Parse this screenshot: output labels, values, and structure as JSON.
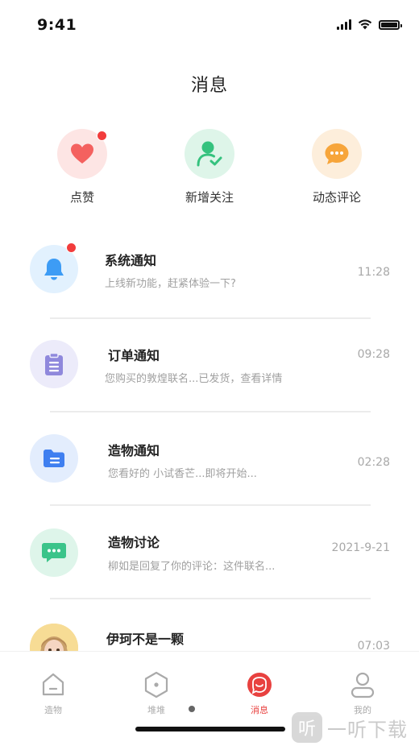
{
  "status_bar": {
    "time": "9:41"
  },
  "header": {
    "title": "消息"
  },
  "quick_actions": [
    {
      "label": "点赞",
      "icon": "heart-icon",
      "color": "#f4615f",
      "bg": "#fde5e4",
      "badge": true
    },
    {
      "label": "新增关注",
      "icon": "user-check-icon",
      "color": "#35c27e",
      "bg": "#def5e9",
      "badge": false
    },
    {
      "label": "动态评论",
      "icon": "chat-bubble-icon",
      "color": "#f7a53a",
      "bg": "#fdeedb",
      "badge": false
    }
  ],
  "messages": [
    {
      "title": "系统通知",
      "preview": "上线新功能，赶紧体验一下?",
      "time": "11:28",
      "icon": "bell-icon",
      "color": "#3d9cf5",
      "bg": "#e2f1fe",
      "badge": true
    },
    {
      "title": "订单通知",
      "preview": "您购买的敦煌联名...已发货，查看详情",
      "time": "09:28",
      "icon": "clipboard-icon",
      "color": "#8f88dc",
      "bg": "#ecebfa",
      "badge": false
    },
    {
      "title": "造物通知",
      "preview": "您看好的 小试香芒...即将开始...",
      "time": "02:28",
      "icon": "folder-icon",
      "color": "#3f7ff0",
      "bg": "#e3edfd",
      "badge": false
    },
    {
      "title": "造物讨论",
      "preview": "柳如是回复了你的评论：这件联名...",
      "time": "2021-9-21",
      "icon": "chat-dots-icon",
      "color": "#3bc48a",
      "bg": "#def5ea",
      "badge": false
    },
    {
      "title": "伊珂不是一颗",
      "preview": "",
      "time": "07:03",
      "icon": "user-avatar",
      "color": "#f2c86a",
      "bg": "#f7dc95",
      "badge": false
    }
  ],
  "tab_bar": {
    "items": [
      {
        "label": "造物",
        "icon": "home-icon",
        "active": false
      },
      {
        "label": "堆堆",
        "icon": "hexagon-icon",
        "active": false
      },
      {
        "label": "消息",
        "icon": "message-icon",
        "active": true
      },
      {
        "label": "我的",
        "icon": "person-icon",
        "active": false
      }
    ],
    "active_color": "#e8413f",
    "inactive_color": "#aaaaaa"
  },
  "watermark": {
    "logo": "听",
    "text": "一听下载"
  }
}
